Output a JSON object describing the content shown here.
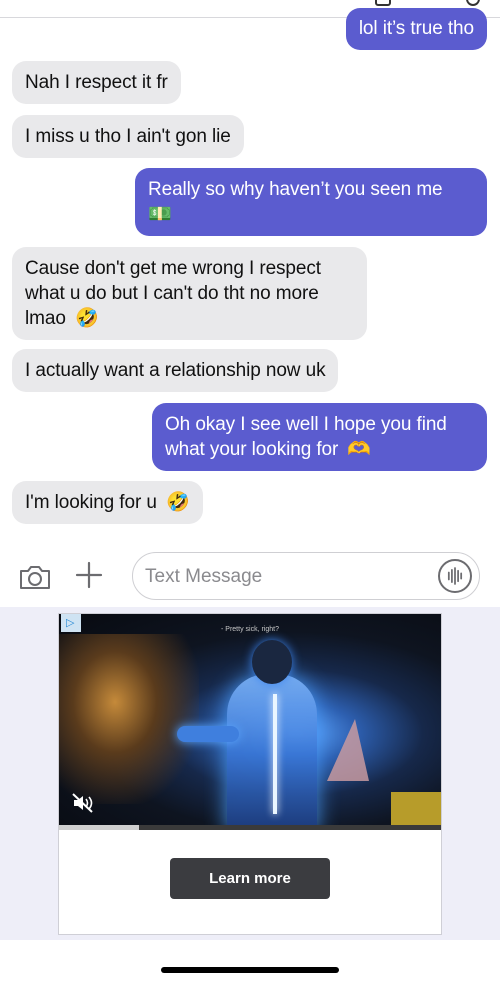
{
  "messages": [
    {
      "dir": "out",
      "text": "lol it’s true tho",
      "emoji": ""
    },
    {
      "dir": "in",
      "text": "Nah I respect it fr",
      "emoji": ""
    },
    {
      "dir": "in",
      "text": "I miss u tho I ain't gon lie",
      "emoji": ""
    },
    {
      "dir": "out",
      "text": "Really so why haven’t you seen me",
      "emoji": "💵"
    },
    {
      "dir": "in",
      "text": "Cause don't get me wrong I respect what u do but I can't do tht no more lmao",
      "emoji": "🤣"
    },
    {
      "dir": "in",
      "text": "I actually want a relationship now uk",
      "emoji": ""
    },
    {
      "dir": "out",
      "text": "Oh okay I see well I hope you find what your looking for",
      "emoji": "🫶"
    },
    {
      "dir": "in",
      "text": "I'm looking for u",
      "emoji": "🤣"
    }
  ],
  "composer": {
    "placeholder": "Text Message",
    "icons": [
      "camera-icon",
      "plus-icon",
      "voice-waveform-icon"
    ]
  },
  "ad": {
    "caption": "- Pretty sick, right?",
    "cta_label": "Learn more",
    "badge_icon": "ad-choices-icon",
    "mute_icon": "speaker-muted-icon",
    "progress": 0.21
  },
  "colors": {
    "outgoing_bubble": "#5b5ccf",
    "incoming_bubble": "#e9e9eb",
    "ad_background": "#eeeef8",
    "cta_button": "#3b3c40"
  }
}
